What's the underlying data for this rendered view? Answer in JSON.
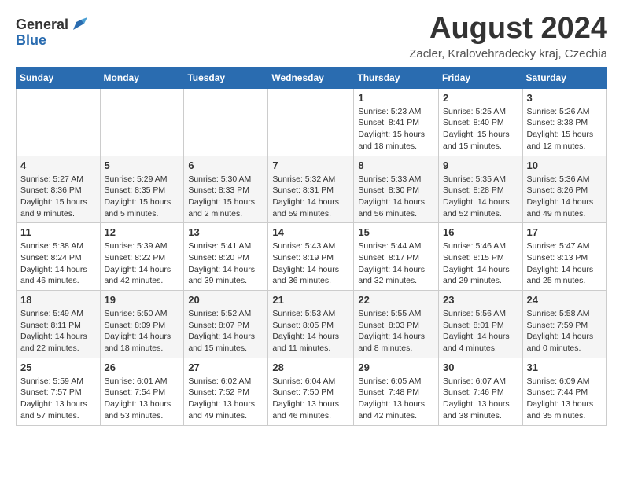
{
  "header": {
    "logo_general": "General",
    "logo_blue": "Blue",
    "month_year": "August 2024",
    "location": "Zacler, Kralovehradecky kraj, Czechia"
  },
  "weekdays": [
    "Sunday",
    "Monday",
    "Tuesday",
    "Wednesday",
    "Thursday",
    "Friday",
    "Saturday"
  ],
  "weeks": [
    [
      {
        "day": "",
        "sunrise": "",
        "sunset": "",
        "daylight": ""
      },
      {
        "day": "",
        "sunrise": "",
        "sunset": "",
        "daylight": ""
      },
      {
        "day": "",
        "sunrise": "",
        "sunset": "",
        "daylight": ""
      },
      {
        "day": "",
        "sunrise": "",
        "sunset": "",
        "daylight": ""
      },
      {
        "day": "1",
        "sunrise": "Sunrise: 5:23 AM",
        "sunset": "Sunset: 8:41 PM",
        "daylight": "Daylight: 15 hours and 18 minutes."
      },
      {
        "day": "2",
        "sunrise": "Sunrise: 5:25 AM",
        "sunset": "Sunset: 8:40 PM",
        "daylight": "Daylight: 15 hours and 15 minutes."
      },
      {
        "day": "3",
        "sunrise": "Sunrise: 5:26 AM",
        "sunset": "Sunset: 8:38 PM",
        "daylight": "Daylight: 15 hours and 12 minutes."
      }
    ],
    [
      {
        "day": "4",
        "sunrise": "Sunrise: 5:27 AM",
        "sunset": "Sunset: 8:36 PM",
        "daylight": "Daylight: 15 hours and 9 minutes."
      },
      {
        "day": "5",
        "sunrise": "Sunrise: 5:29 AM",
        "sunset": "Sunset: 8:35 PM",
        "daylight": "Daylight: 15 hours and 5 minutes."
      },
      {
        "day": "6",
        "sunrise": "Sunrise: 5:30 AM",
        "sunset": "Sunset: 8:33 PM",
        "daylight": "Daylight: 15 hours and 2 minutes."
      },
      {
        "day": "7",
        "sunrise": "Sunrise: 5:32 AM",
        "sunset": "Sunset: 8:31 PM",
        "daylight": "Daylight: 14 hours and 59 minutes."
      },
      {
        "day": "8",
        "sunrise": "Sunrise: 5:33 AM",
        "sunset": "Sunset: 8:30 PM",
        "daylight": "Daylight: 14 hours and 56 minutes."
      },
      {
        "day": "9",
        "sunrise": "Sunrise: 5:35 AM",
        "sunset": "Sunset: 8:28 PM",
        "daylight": "Daylight: 14 hours and 52 minutes."
      },
      {
        "day": "10",
        "sunrise": "Sunrise: 5:36 AM",
        "sunset": "Sunset: 8:26 PM",
        "daylight": "Daylight: 14 hours and 49 minutes."
      }
    ],
    [
      {
        "day": "11",
        "sunrise": "Sunrise: 5:38 AM",
        "sunset": "Sunset: 8:24 PM",
        "daylight": "Daylight: 14 hours and 46 minutes."
      },
      {
        "day": "12",
        "sunrise": "Sunrise: 5:39 AM",
        "sunset": "Sunset: 8:22 PM",
        "daylight": "Daylight: 14 hours and 42 minutes."
      },
      {
        "day": "13",
        "sunrise": "Sunrise: 5:41 AM",
        "sunset": "Sunset: 8:20 PM",
        "daylight": "Daylight: 14 hours and 39 minutes."
      },
      {
        "day": "14",
        "sunrise": "Sunrise: 5:43 AM",
        "sunset": "Sunset: 8:19 PM",
        "daylight": "Daylight: 14 hours and 36 minutes."
      },
      {
        "day": "15",
        "sunrise": "Sunrise: 5:44 AM",
        "sunset": "Sunset: 8:17 PM",
        "daylight": "Daylight: 14 hours and 32 minutes."
      },
      {
        "day": "16",
        "sunrise": "Sunrise: 5:46 AM",
        "sunset": "Sunset: 8:15 PM",
        "daylight": "Daylight: 14 hours and 29 minutes."
      },
      {
        "day": "17",
        "sunrise": "Sunrise: 5:47 AM",
        "sunset": "Sunset: 8:13 PM",
        "daylight": "Daylight: 14 hours and 25 minutes."
      }
    ],
    [
      {
        "day": "18",
        "sunrise": "Sunrise: 5:49 AM",
        "sunset": "Sunset: 8:11 PM",
        "daylight": "Daylight: 14 hours and 22 minutes."
      },
      {
        "day": "19",
        "sunrise": "Sunrise: 5:50 AM",
        "sunset": "Sunset: 8:09 PM",
        "daylight": "Daylight: 14 hours and 18 minutes."
      },
      {
        "day": "20",
        "sunrise": "Sunrise: 5:52 AM",
        "sunset": "Sunset: 8:07 PM",
        "daylight": "Daylight: 14 hours and 15 minutes."
      },
      {
        "day": "21",
        "sunrise": "Sunrise: 5:53 AM",
        "sunset": "Sunset: 8:05 PM",
        "daylight": "Daylight: 14 hours and 11 minutes."
      },
      {
        "day": "22",
        "sunrise": "Sunrise: 5:55 AM",
        "sunset": "Sunset: 8:03 PM",
        "daylight": "Daylight: 14 hours and 8 minutes."
      },
      {
        "day": "23",
        "sunrise": "Sunrise: 5:56 AM",
        "sunset": "Sunset: 8:01 PM",
        "daylight": "Daylight: 14 hours and 4 minutes."
      },
      {
        "day": "24",
        "sunrise": "Sunrise: 5:58 AM",
        "sunset": "Sunset: 7:59 PM",
        "daylight": "Daylight: 14 hours and 0 minutes."
      }
    ],
    [
      {
        "day": "25",
        "sunrise": "Sunrise: 5:59 AM",
        "sunset": "Sunset: 7:57 PM",
        "daylight": "Daylight: 13 hours and 57 minutes."
      },
      {
        "day": "26",
        "sunrise": "Sunrise: 6:01 AM",
        "sunset": "Sunset: 7:54 PM",
        "daylight": "Daylight: 13 hours and 53 minutes."
      },
      {
        "day": "27",
        "sunrise": "Sunrise: 6:02 AM",
        "sunset": "Sunset: 7:52 PM",
        "daylight": "Daylight: 13 hours and 49 minutes."
      },
      {
        "day": "28",
        "sunrise": "Sunrise: 6:04 AM",
        "sunset": "Sunset: 7:50 PM",
        "daylight": "Daylight: 13 hours and 46 minutes."
      },
      {
        "day": "29",
        "sunrise": "Sunrise: 6:05 AM",
        "sunset": "Sunset: 7:48 PM",
        "daylight": "Daylight: 13 hours and 42 minutes."
      },
      {
        "day": "30",
        "sunrise": "Sunrise: 6:07 AM",
        "sunset": "Sunset: 7:46 PM",
        "daylight": "Daylight: 13 hours and 38 minutes."
      },
      {
        "day": "31",
        "sunrise": "Sunrise: 6:09 AM",
        "sunset": "Sunset: 7:44 PM",
        "daylight": "Daylight: 13 hours and 35 minutes."
      }
    ]
  ]
}
